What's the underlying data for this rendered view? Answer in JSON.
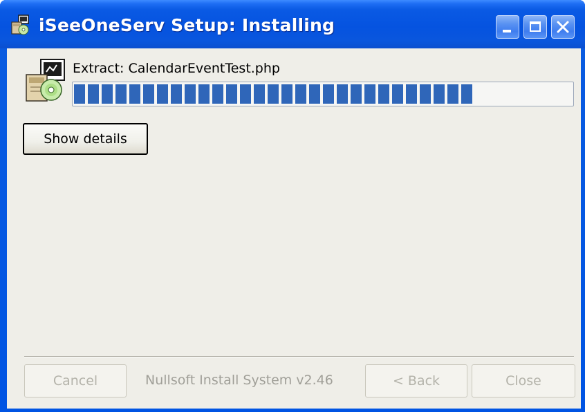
{
  "window": {
    "title": "iSeeOneServ Setup: Installing"
  },
  "titlebar_buttons": {
    "minimize": "minimize-icon",
    "maximize": "maximize-icon",
    "close": "close-icon"
  },
  "main": {
    "status": "Extract: CalendarEventTest.php",
    "progress_percent": 80,
    "show_details_label": "Show details"
  },
  "footer": {
    "cancel_label": "Cancel",
    "branding": "Nullsoft Install System v2.46",
    "back_label": "< Back",
    "close_label": "Close"
  },
  "colors": {
    "titlebar": "#0054e3",
    "progress": "#2f66b9",
    "dialog_bg": "#efeee8",
    "disabled_text": "#b4b3aa"
  }
}
